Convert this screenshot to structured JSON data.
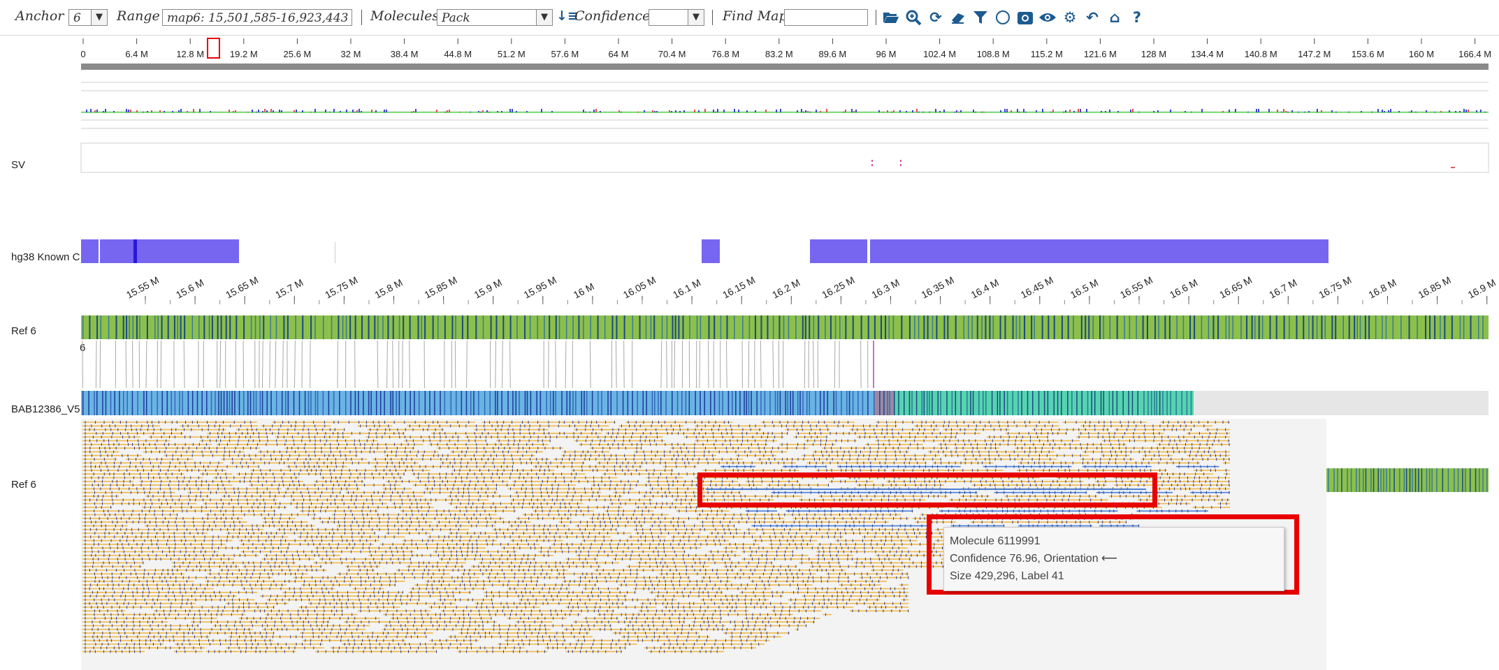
{
  "toolbar": {
    "anchor_label": "Anchor",
    "anchor_value": "6",
    "range_label": "Range",
    "range_value": "map6: 15,501,585-16,923,443",
    "molecules_label": "Molecules",
    "molecules_value": "Pack",
    "confidence_label": "Confidence",
    "confidence_value": "",
    "find_map_label": "Find Map",
    "find_map_value": "",
    "icons": [
      "folder-open-icon",
      "zoom-icon",
      "refresh-icon",
      "eraser-icon",
      "filter-icon",
      "circle-icon",
      "camera-icon",
      "eye-icon",
      "settings-icon",
      "undo-icon",
      "home-icon",
      "help-icon"
    ]
  },
  "overview_axis": {
    "ticks": [
      "0",
      "6.4 M",
      "12.8 M",
      "19.2 M",
      "25.6 M",
      "32 M",
      "38.4 M",
      "44.8 M",
      "51.2 M",
      "57.6 M",
      "64 M",
      "70.4 M",
      "76.8 M",
      "83.2 M",
      "89.6 M",
      "96 M",
      "102.4 M",
      "108.8 M",
      "115.2 M",
      "121.6 M",
      "128 M",
      "134.4 M",
      "140.8 M",
      "147.2 M",
      "153.6 M",
      "160 M",
      "166.4 M"
    ]
  },
  "detail_axis": {
    "ticks": [
      "15.55 M",
      "15.6 M",
      "15.65 M",
      "15.7 M",
      "15.75 M",
      "15.8 M",
      "15.85 M",
      "15.9 M",
      "15.95 M",
      "16 M",
      "16.05 M",
      "16.1 M",
      "16.15 M",
      "16.2 M",
      "16.25 M",
      "16.3 M",
      "16.35 M",
      "16.4 M",
      "16.45 M",
      "16.5 M",
      "16.55 M",
      "16.6 M",
      "16.65 M",
      "16.7 M",
      "16.75 M",
      "16.8 M",
      "16.85 M",
      "16.9 M"
    ]
  },
  "lanes": {
    "sv": "SV",
    "known": "hg38 Known C",
    "ref_top": "Ref 6",
    "ref_top_sub": "6",
    "query": "BAB12386_V5",
    "ref_bottom": "Ref 6"
  },
  "tooltip": {
    "line1": "Molecule 6119991",
    "line2": "Confidence 76.96, Orientation ⟵",
    "line3": "Size 429,296, Label 41"
  },
  "colors": {
    "accent_red": "#e80000",
    "ref_green": "#8cc04a",
    "query_blue": "#6ab4e4",
    "query_teal": "#56d4b0",
    "known_purple": "#7766f0",
    "molecule_orange": "#f0b84a"
  }
}
